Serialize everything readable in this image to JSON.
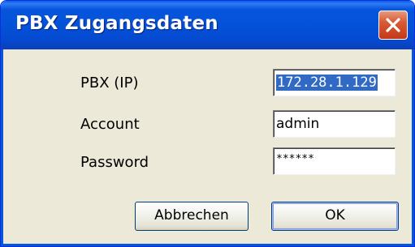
{
  "window": {
    "title": "PBX Zugangsdaten"
  },
  "form": {
    "fields": [
      {
        "label": "PBX (IP)",
        "value": "172.28.1.129",
        "selected": true
      },
      {
        "label": "Account",
        "value": "admin"
      },
      {
        "label": "Password",
        "value": "******"
      }
    ]
  },
  "buttons": {
    "cancel_label": "Abbrechen",
    "ok_label": "OK"
  },
  "colors": {
    "titlebar": "#0352d8",
    "dialog_background": "#ece9d8",
    "selection": "#316ac5",
    "close_button": "#d85a34"
  },
  "icons": {
    "close": "close-icon"
  }
}
